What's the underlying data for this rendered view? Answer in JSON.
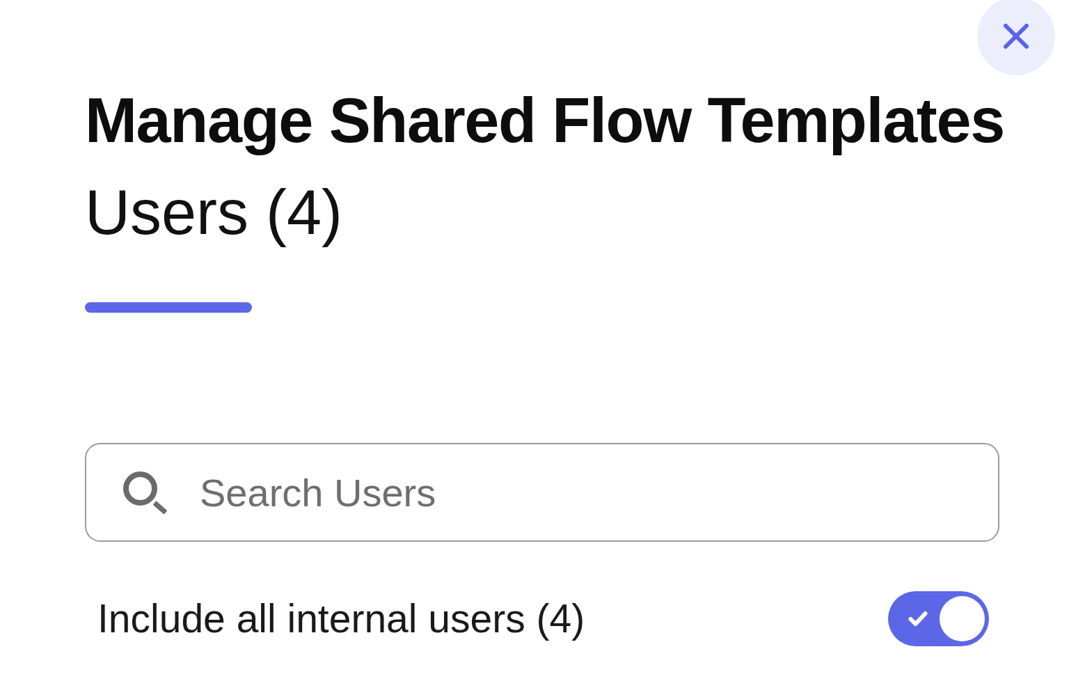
{
  "dialog": {
    "title": "Manage Shared Flow Templates"
  },
  "tabs": [
    {
      "label": "Users (4)",
      "selected": true
    }
  ],
  "search": {
    "placeholder": "Search Users"
  },
  "include_internal_users": {
    "label": "Include all internal users (4)",
    "on": true
  }
}
